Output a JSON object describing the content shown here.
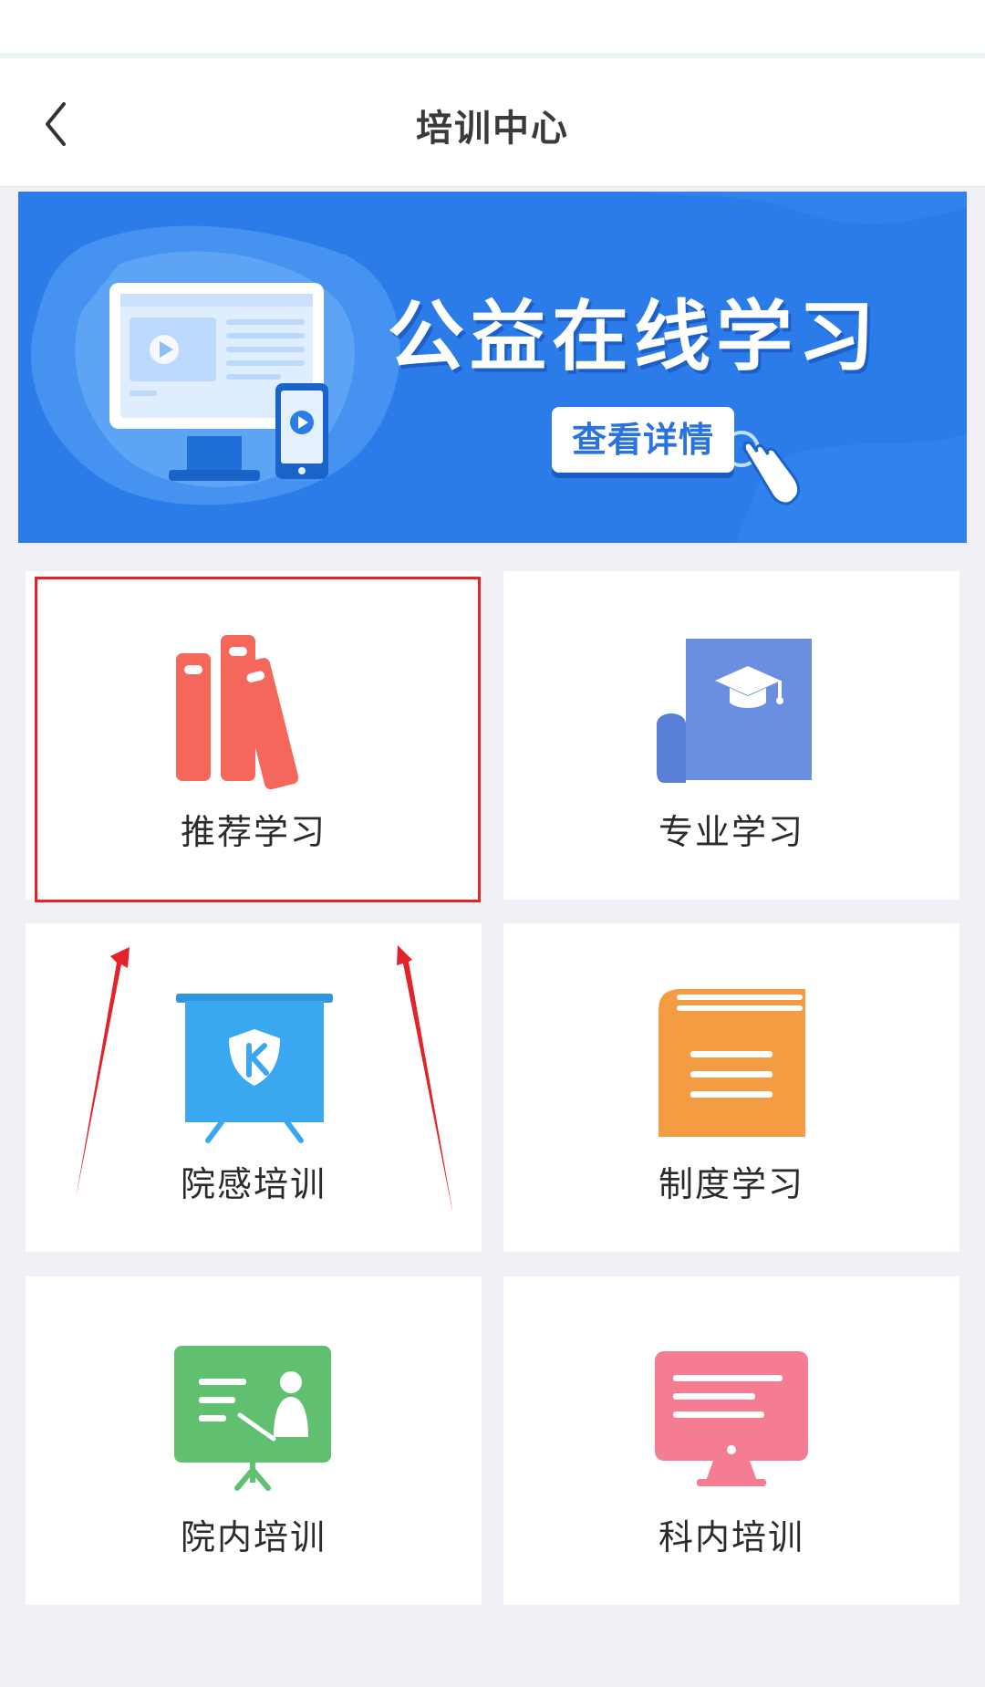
{
  "header": {
    "title": "培训中心",
    "back_icon": "chevron-left-icon"
  },
  "banner": {
    "title": "公益在线学习",
    "button_label": "查看详情"
  },
  "menu": {
    "items": [
      {
        "label": "推荐学习",
        "icon": "books-icon",
        "color": "#f4675a"
      },
      {
        "label": "专业学习",
        "icon": "graduation-cap-icon",
        "color": "#6b8fe0"
      },
      {
        "label": "院感培训",
        "icon": "shield-presentation-icon",
        "color": "#3aa7f1"
      },
      {
        "label": "制度学习",
        "icon": "book-icon",
        "color": "#f39c42"
      },
      {
        "label": "院内培训",
        "icon": "lecturer-board-icon",
        "color": "#61c06f"
      },
      {
        "label": "科内培训",
        "icon": "monitor-icon",
        "color": "#f47d94"
      }
    ]
  },
  "annotation": {
    "highlight_color": "#e0242a"
  }
}
